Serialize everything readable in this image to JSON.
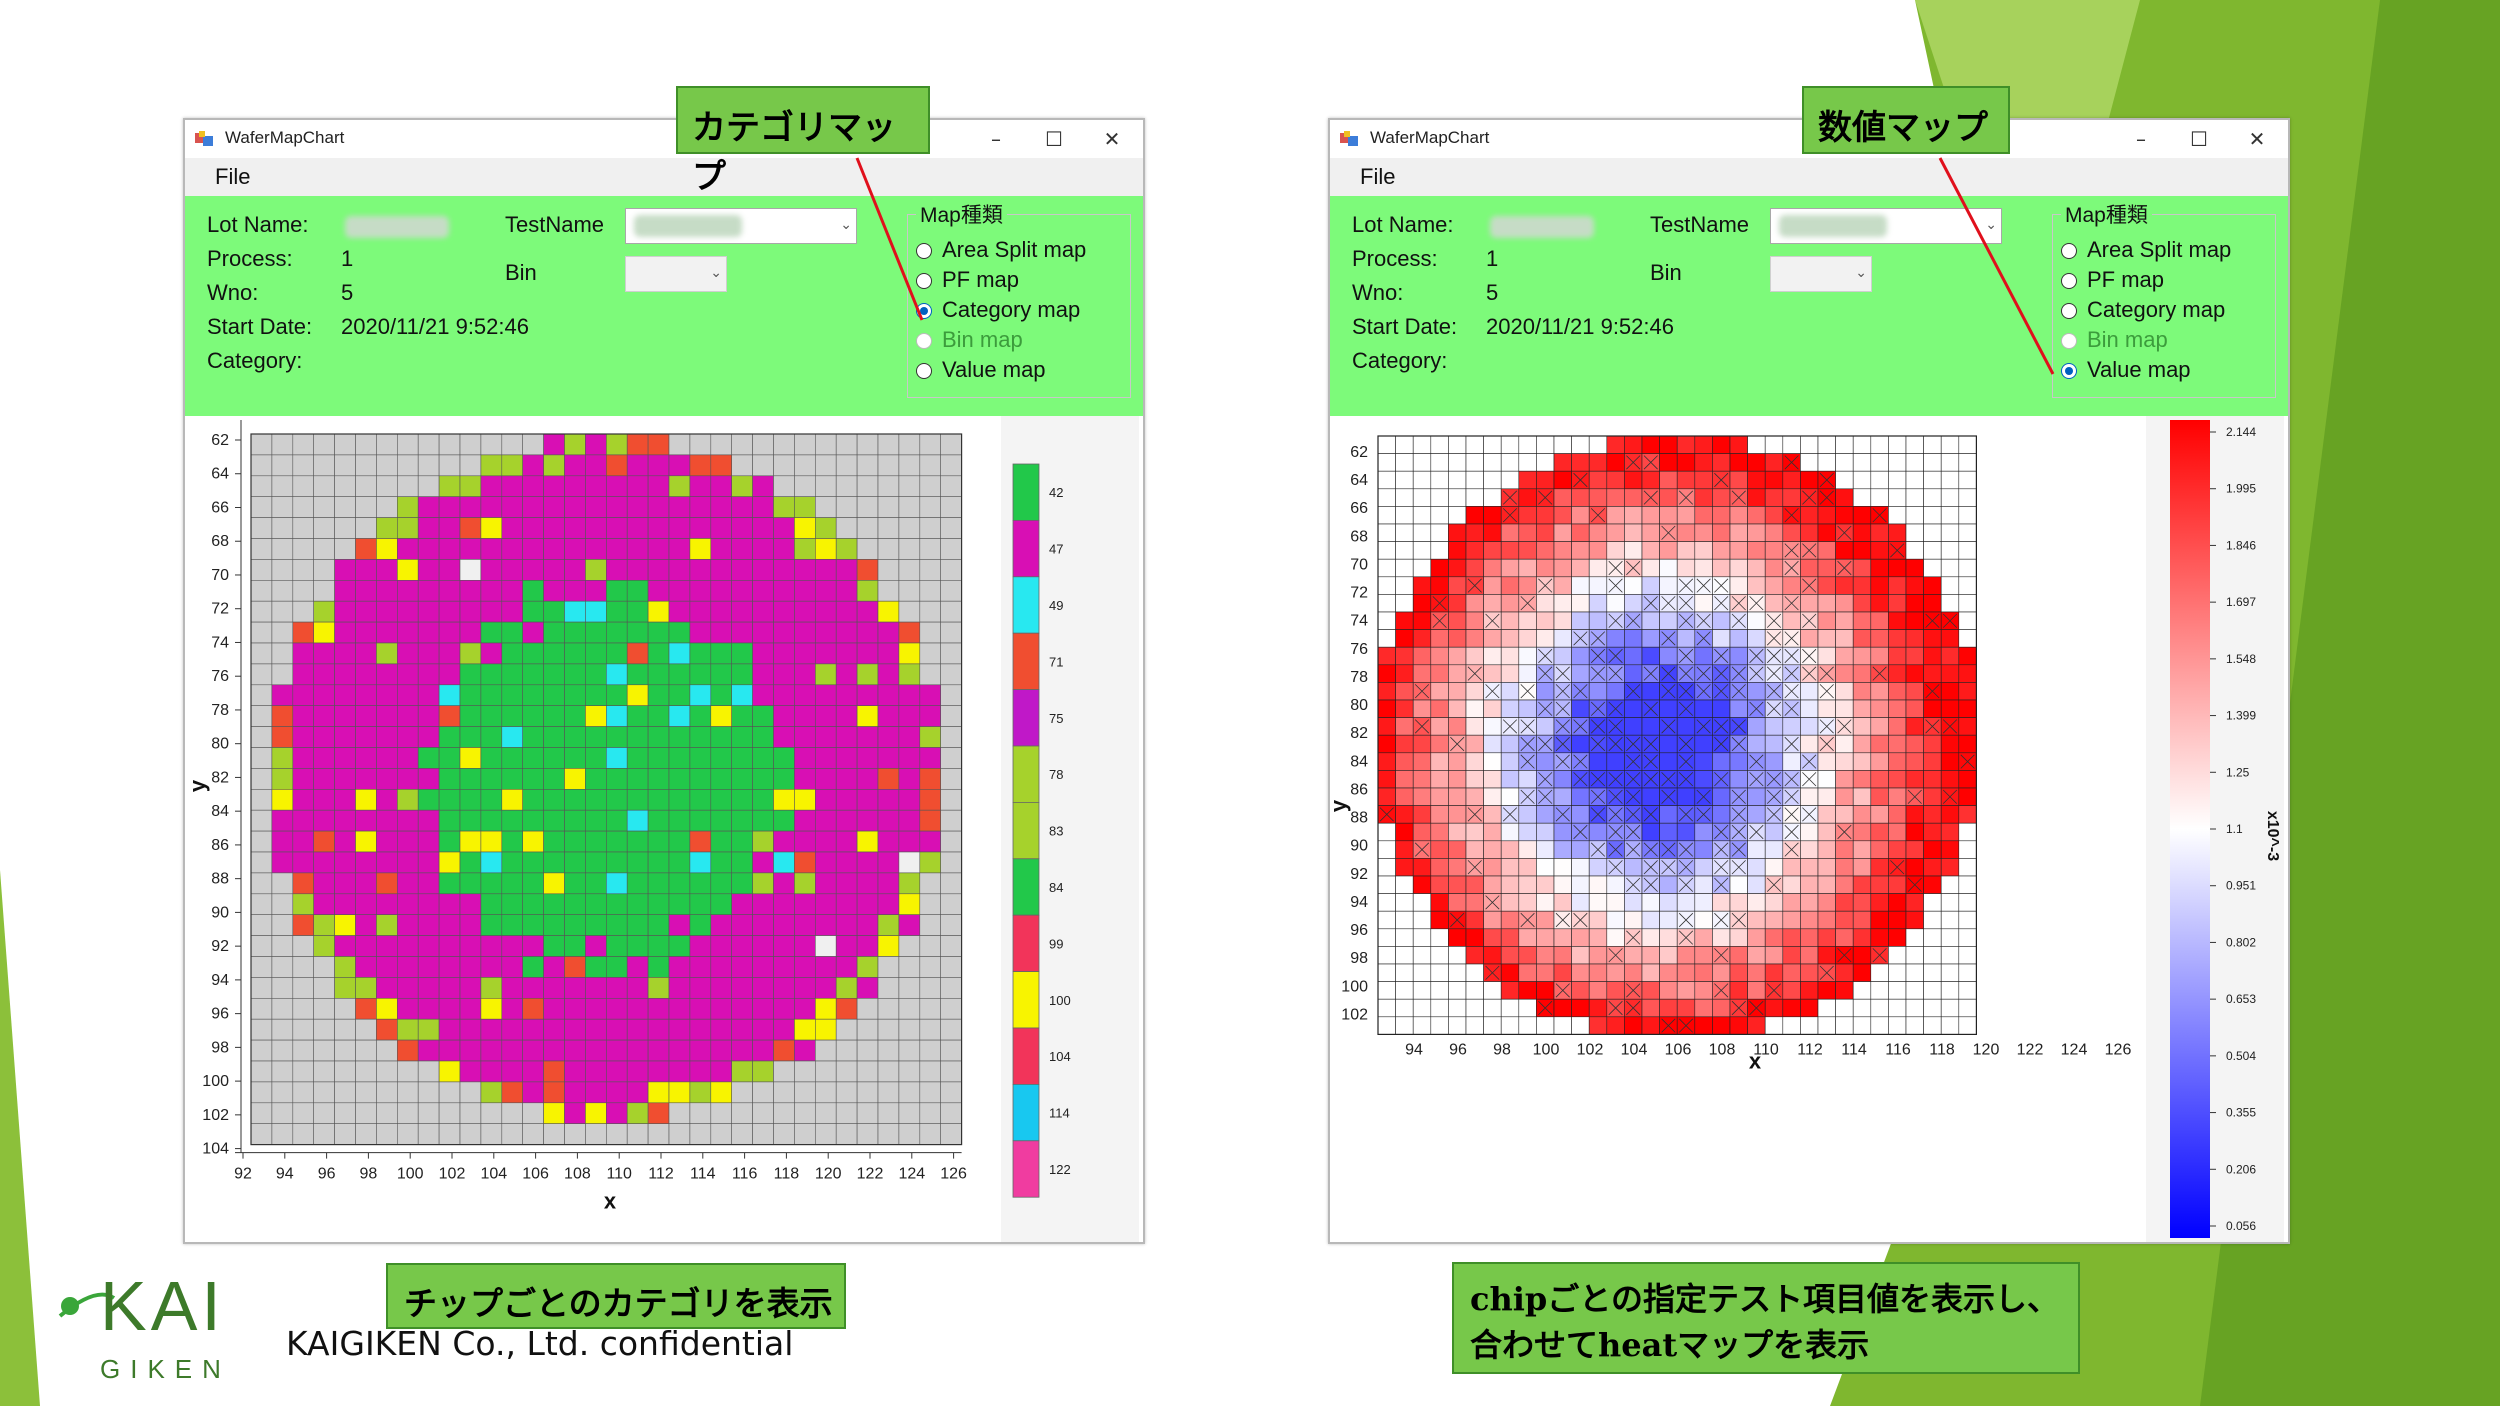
{
  "company": {
    "logo_text": "KAI",
    "logo_subtext": "GIKEN",
    "confidential": "KAIGIKEN Co., Ltd. confidential"
  },
  "left_window": {
    "title": "WaferMapChart",
    "menu_file": "File",
    "callout": "カテゴリマップ",
    "caption": "チップごとのカテゴリを表示",
    "info": {
      "lot_label": "Lot Name:",
      "process_label": "Process:",
      "process_value": "1",
      "wno_label": "Wno:",
      "wno_value": "5",
      "start_label": "Start Date:",
      "start_value": "2020/11/21 9:52:46",
      "category_label": "Category:",
      "testname_label": "TestName",
      "bin_label": "Bin"
    },
    "map_group": {
      "title": "Map種類",
      "options": [
        "Area Split map",
        "PF map",
        "Category map",
        "Bin map",
        "Value map"
      ],
      "selected": "Category map",
      "disabled": "Bin map"
    },
    "chart": {
      "xlabel": "x",
      "ylabel": "y",
      "x_ticks": [
        "92",
        "94",
        "96",
        "98",
        "100",
        "102",
        "104",
        "106",
        "108",
        "110",
        "112",
        "114",
        "116",
        "118",
        "120",
        "122",
        "124",
        "126"
      ],
      "y_ticks": [
        "62",
        "64",
        "66",
        "68",
        "70",
        "72",
        "74",
        "76",
        "78",
        "80",
        "82",
        "84",
        "86",
        "88",
        "90",
        "92",
        "94",
        "96",
        "98",
        "100",
        "102",
        "104"
      ],
      "legend": [
        {
          "label": "42",
          "color": "#22c84a"
        },
        {
          "label": "47",
          "color": "#d80fb4"
        },
        {
          "label": "49",
          "color": "#28e8f0"
        },
        {
          "label": "71",
          "color": "#f04e30"
        },
        {
          "label": "75",
          "color": "#c018c8"
        },
        {
          "label": "78",
          "color": "#a6d22c"
        },
        {
          "label": "83",
          "color": "#a6d22c"
        },
        {
          "label": "84",
          "color": "#22c84a"
        },
        {
          "label": "99",
          "color": "#f2345a"
        },
        {
          "label": "100",
          "color": "#f8f400"
        },
        {
          "label": "104",
          "color": "#f2345a"
        },
        {
          "label": "114",
          "color": "#18c8f0"
        },
        {
          "label": "122",
          "color": "#f03ca0"
        }
      ]
    }
  },
  "right_window": {
    "title": "WaferMapChart",
    "menu_file": "File",
    "callout": "数値マップ",
    "caption_line1": "chipごとの指定テスト項目値を表示し、",
    "caption_line2": "合わせてheatマップを表示",
    "info": {
      "lot_label": "Lot Name:",
      "process_label": "Process:",
      "process_value": "1",
      "wno_label": "Wno:",
      "wno_value": "5",
      "start_label": "Start Date:",
      "start_value": "2020/11/21 9:52:46",
      "category_label": "Category:",
      "testname_label": "TestName",
      "bin_label": "Bin"
    },
    "map_group": {
      "title": "Map種類",
      "options": [
        "Area Split map",
        "PF map",
        "Category map",
        "Bin map",
        "Value map"
      ],
      "selected": "Value map",
      "disabled": "Bin map"
    },
    "chart": {
      "xlabel": "x",
      "ylabel": "y",
      "x_ticks": [
        "94",
        "96",
        "98",
        "100",
        "102",
        "104",
        "106",
        "108",
        "110",
        "112",
        "114",
        "116",
        "118",
        "120",
        "122",
        "124",
        "126"
      ],
      "y_ticks": [
        "62",
        "64",
        "66",
        "68",
        "70",
        "72",
        "74",
        "76",
        "78",
        "80",
        "82",
        "84",
        "86",
        "88",
        "90",
        "92",
        "94",
        "96",
        "98",
        "100",
        "102"
      ],
      "colorbar_ticks": [
        "2.144",
        "1.995",
        "1.846",
        "1.697",
        "1.548",
        "1.399",
        "1.25",
        "1.1",
        "0.951",
        "0.802",
        "0.653",
        "0.504",
        "0.355",
        "0.206",
        "0.056"
      ],
      "colorbar_label": "x10^-3",
      "colors": {
        "high": "#ff0000",
        "mid": "#ffffff",
        "low": "#0000ff"
      }
    }
  }
}
